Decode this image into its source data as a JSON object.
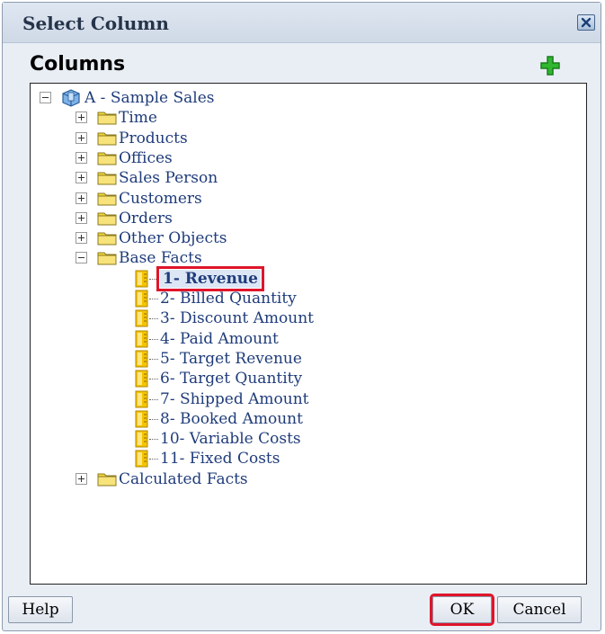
{
  "dialog": {
    "title": "Select Column",
    "section_title": "Columns",
    "add_icon": "green-plus-icon",
    "close_icon": "close-x-icon"
  },
  "tree": {
    "root": {
      "label": "A - Sample Sales",
      "icon": "cube-icon"
    },
    "folders_before": [
      "Time",
      "Products",
      "Offices",
      "Sales Person",
      "Customers",
      "Orders",
      "Other Objects"
    ],
    "expanded_folder": {
      "label": "Base Facts",
      "columns": [
        "1- Revenue",
        "2- Billed Quantity",
        "3- Discount Amount",
        "4- Paid Amount",
        "5- Target Revenue",
        "6- Target Quantity",
        "7- Shipped Amount",
        "8- Booked Amount",
        "10- Variable Costs",
        "11- Fixed Costs"
      ],
      "selected_index": 0
    },
    "folders_after": [
      "Calculated Facts"
    ]
  },
  "footer": {
    "help_label": "Help",
    "ok_label": "OK",
    "cancel_label": "Cancel"
  },
  "colors": {
    "highlight": "#e0152a",
    "link_text": "#1f3c7a",
    "folder": "#f2d63a",
    "column_icon": "#f5c400"
  }
}
